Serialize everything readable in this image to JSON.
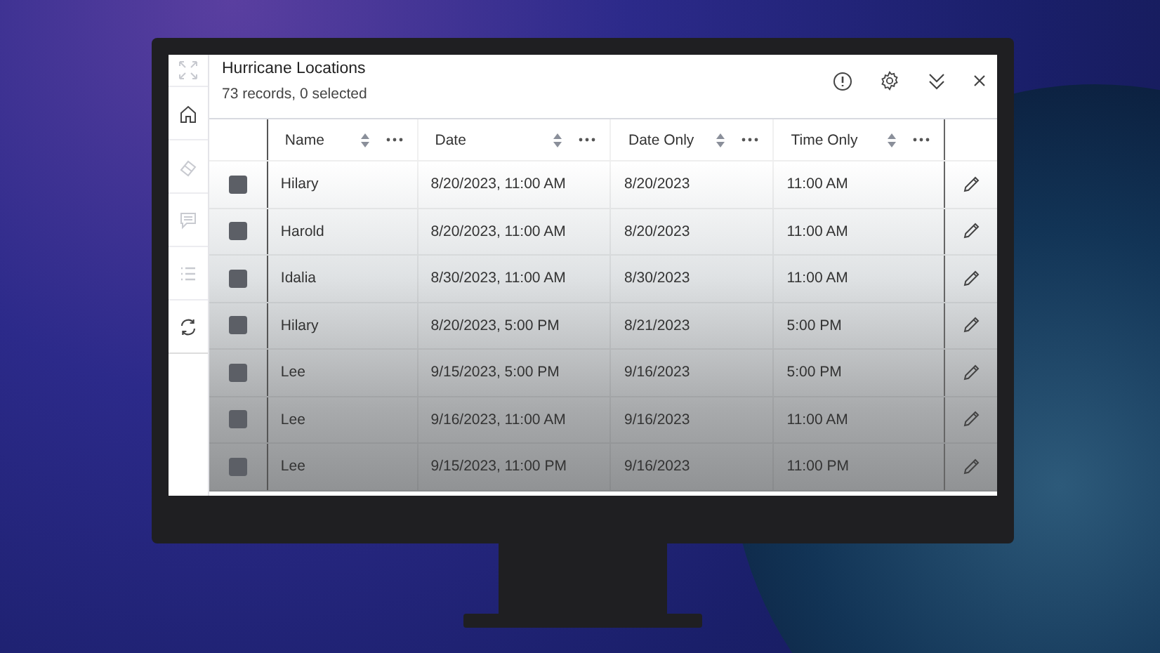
{
  "sidebar": {
    "items": [
      {
        "kind": "expand",
        "disabled": true
      },
      {
        "kind": "home",
        "disabled": false
      },
      {
        "kind": "eraser",
        "disabled": true
      },
      {
        "kind": "comment",
        "disabled": true
      },
      {
        "kind": "list",
        "disabled": true
      },
      {
        "kind": "refresh",
        "disabled": false
      }
    ]
  },
  "panel": {
    "title": "Hurricane Locations",
    "subtitle": "73 records, 0 selected"
  },
  "table": {
    "columns": [
      "Name",
      "Date",
      "Date Only",
      "Time Only"
    ],
    "rows": [
      {
        "checked": false,
        "cells": [
          "Hilary",
          "8/20/2023, 11:00 AM",
          "8/20/2023",
          "11:00 AM"
        ]
      },
      {
        "checked": false,
        "cells": [
          "Harold",
          "8/20/2023, 11:00 AM",
          "8/20/2023",
          "11:00 AM"
        ]
      },
      {
        "checked": false,
        "cells": [
          "Idalia",
          "8/30/2023, 11:00 AM",
          "8/30/2023",
          "11:00 AM"
        ]
      },
      {
        "checked": false,
        "cells": [
          "Hilary",
          "8/20/2023, 5:00 PM",
          "8/21/2023",
          "5:00 PM"
        ]
      },
      {
        "checked": false,
        "cells": [
          "Lee",
          "9/15/2023, 5:00 PM",
          "9/16/2023",
          "5:00 PM"
        ]
      },
      {
        "checked": false,
        "cells": [
          "Lee",
          "9/16/2023, 11:00 AM",
          "9/16/2023",
          "11:00 AM"
        ]
      },
      {
        "checked": false,
        "cells": [
          "Lee",
          "9/15/2023, 11:00 PM",
          "9/16/2023",
          "11:00 PM"
        ]
      }
    ]
  }
}
